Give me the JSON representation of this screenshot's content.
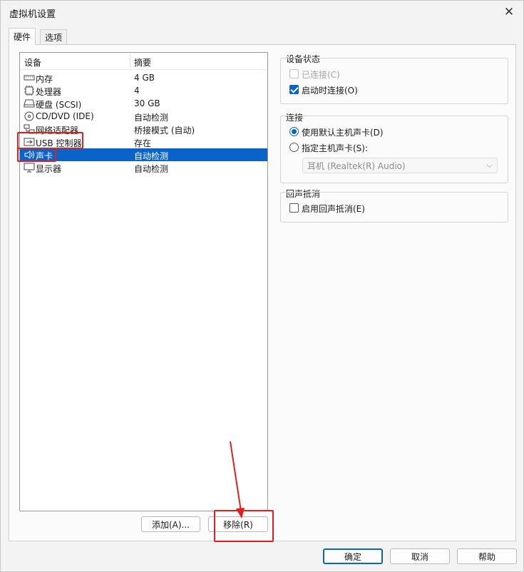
{
  "window": {
    "title": "虚拟机设置",
    "close_glyph": "✕"
  },
  "tabs": [
    {
      "label": "硬件"
    },
    {
      "label": "选项"
    }
  ],
  "device_list": {
    "columns": {
      "device": "设备",
      "summary": "摘要"
    },
    "rows": [
      {
        "name": "内存",
        "summary": "4 GB",
        "icon": "memory-icon"
      },
      {
        "name": "处理器",
        "summary": "4",
        "icon": "processor-icon"
      },
      {
        "name": "硬盘 (SCSI)",
        "summary": "30 GB",
        "icon": "hard-disk-icon"
      },
      {
        "name": "CD/DVD (IDE)",
        "summary": "自动检测",
        "icon": "cd-dvd-icon"
      },
      {
        "name": "网络适配器",
        "summary": "桥接模式 (自动)",
        "icon": "network-adapter-icon"
      },
      {
        "name": "USB 控制器",
        "summary": "存在",
        "icon": "usb-controller-icon"
      },
      {
        "name": "声卡",
        "summary": "自动检测",
        "icon": "sound-card-icon",
        "selected": true
      },
      {
        "name": "显示器",
        "summary": "自动检测",
        "icon": "display-icon"
      }
    ]
  },
  "list_buttons": {
    "add": "添加(A)...",
    "remove": "移除(R)"
  },
  "device_status": {
    "title": "设备状态",
    "connected": {
      "label": "已连接(C)",
      "checked": false,
      "disabled": true
    },
    "connect_at_power_on": {
      "label": "启动时连接(O)",
      "checked": true
    }
  },
  "connection": {
    "title": "连接",
    "use_default": {
      "label": "使用默认主机声卡(D)",
      "checked": true
    },
    "specify": {
      "label": "指定主机声卡(S):",
      "checked": false
    },
    "device_select": "耳机 (Realtek(R) Audio)"
  },
  "echo": {
    "title": "回声抵消",
    "enable": {
      "label": "启用回声抵消(E)",
      "checked": false
    }
  },
  "footer": {
    "ok": "确定",
    "cancel": "取消",
    "help": "帮助"
  },
  "colors": {
    "accent": "#0a63c9",
    "annotation": "#e02020"
  }
}
